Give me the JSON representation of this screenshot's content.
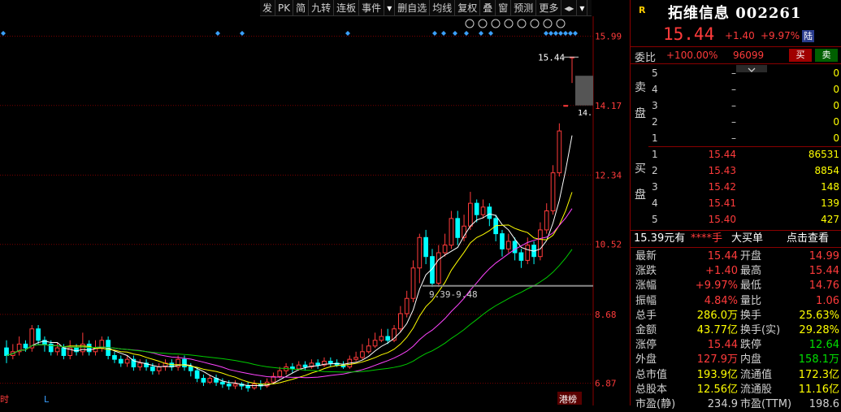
{
  "toolbar": {
    "items": [
      "发",
      "PK",
      "简",
      "九转",
      "连板",
      "事件",
      "▾",
      "删自选",
      "均线",
      "复权",
      "叠",
      "窗",
      "预测",
      "更多",
      "◂▸",
      "▾"
    ]
  },
  "chart": {
    "price_labels": [
      "15.99",
      "14.17",
      "12.34",
      "10.52",
      "8.68",
      "6.87"
    ],
    "last_price_label": "15.44",
    "side_price_label": "14.",
    "gap_annotation": "9.39-9.48",
    "bottom_left": "时",
    "bottom_mid": "L",
    "bottom_right": "港榜",
    "colors": {
      "up": "#ff3b3b",
      "down": "#00ffff",
      "ma5": "#ffffff",
      "ma10": "#ffff00",
      "ma20": "#ff44ff",
      "ma60": "#00cc00"
    }
  },
  "chart_data": {
    "type": "candlestick",
    "ylim": [
      6.5,
      16.3
    ],
    "candles": [
      [
        7.8,
        7.6,
        8.0,
        7.4
      ],
      [
        7.6,
        7.7,
        7.9,
        7.5
      ],
      [
        7.7,
        7.9,
        8.1,
        7.6
      ],
      [
        7.9,
        7.8,
        8.0,
        7.7
      ],
      [
        7.8,
        8.3,
        8.4,
        7.7
      ],
      [
        8.3,
        8.0,
        8.4,
        7.9
      ],
      [
        8.0,
        7.9,
        8.1,
        7.7
      ],
      [
        7.9,
        7.7,
        8.0,
        7.6
      ],
      [
        7.7,
        7.8,
        7.95,
        7.6
      ],
      [
        7.8,
        7.6,
        7.9,
        7.5
      ],
      [
        7.6,
        7.8,
        8.0,
        7.5
      ],
      [
        7.8,
        7.7,
        7.9,
        7.6
      ],
      [
        7.7,
        7.9,
        8.2,
        7.6
      ],
      [
        7.9,
        7.7,
        8.0,
        7.6
      ],
      [
        7.7,
        7.8,
        8.0,
        7.6
      ],
      [
        7.8,
        8.0,
        8.1,
        7.7
      ],
      [
        8.0,
        7.6,
        8.1,
        7.5
      ],
      [
        7.6,
        7.5,
        7.7,
        7.4
      ],
      [
        7.5,
        7.4,
        7.6,
        7.3
      ],
      [
        7.4,
        7.5,
        7.6,
        7.3
      ],
      [
        7.5,
        7.3,
        7.6,
        7.2
      ],
      [
        7.3,
        7.4,
        7.5,
        7.2
      ],
      [
        7.4,
        7.3,
        7.5,
        7.2
      ],
      [
        7.3,
        7.2,
        7.4,
        7.1
      ],
      [
        7.2,
        7.3,
        7.4,
        7.1
      ],
      [
        7.3,
        7.4,
        7.5,
        7.2
      ],
      [
        7.4,
        7.3,
        7.5,
        7.2
      ],
      [
        7.3,
        7.5,
        7.6,
        7.2
      ],
      [
        7.5,
        7.3,
        7.6,
        7.2
      ],
      [
        7.3,
        7.2,
        7.4,
        7.05
      ],
      [
        7.2,
        7.0,
        7.3,
        6.9
      ],
      [
        7.0,
        6.9,
        7.1,
        6.8
      ],
      [
        6.9,
        7.0,
        7.1,
        6.85
      ],
      [
        7.0,
        6.9,
        7.1,
        6.8
      ],
      [
        6.9,
        6.85,
        7.0,
        6.75
      ],
      [
        6.85,
        6.8,
        6.95,
        6.7
      ],
      [
        6.8,
        6.85,
        6.95,
        6.72
      ],
      [
        6.85,
        6.8,
        6.9,
        6.7
      ],
      [
        6.8,
        6.75,
        6.9,
        6.65
      ],
      [
        6.75,
        6.85,
        6.95,
        6.7
      ],
      [
        6.85,
        6.8,
        6.95,
        6.7
      ],
      [
        6.8,
        6.9,
        7.0,
        6.75
      ],
      [
        6.9,
        7.05,
        7.15,
        6.85
      ],
      [
        7.05,
        7.2,
        7.3,
        7.0
      ],
      [
        7.2,
        7.3,
        7.4,
        7.1
      ],
      [
        7.3,
        7.25,
        7.4,
        7.15
      ],
      [
        7.25,
        7.35,
        7.45,
        7.2
      ],
      [
        7.35,
        7.3,
        7.45,
        7.2
      ],
      [
        7.3,
        7.4,
        7.5,
        7.25
      ],
      [
        7.4,
        7.35,
        7.5,
        7.25
      ],
      [
        7.35,
        7.45,
        7.55,
        7.3
      ],
      [
        7.45,
        7.4,
        7.55,
        7.3
      ],
      [
        7.4,
        7.35,
        7.5,
        7.3
      ],
      [
        7.35,
        7.3,
        7.45,
        7.25
      ],
      [
        7.3,
        7.5,
        7.6,
        7.25
      ],
      [
        7.5,
        7.55,
        7.7,
        7.45
      ],
      [
        7.55,
        7.7,
        7.9,
        7.5
      ],
      [
        7.7,
        7.85,
        8.05,
        7.65
      ],
      [
        7.85,
        8.0,
        8.2,
        7.8
      ],
      [
        8.0,
        8.1,
        8.3,
        7.95
      ],
      [
        8.1,
        8.0,
        8.3,
        7.9
      ],
      [
        8.0,
        8.3,
        8.4,
        7.95
      ],
      [
        8.3,
        8.7,
        8.9,
        8.2
      ],
      [
        8.7,
        9.1,
        9.3,
        8.6
      ],
      [
        9.1,
        9.9,
        10.1,
        9.0
      ],
      [
        9.9,
        10.7,
        10.8,
        9.5
      ],
      [
        10.7,
        10.2,
        10.9,
        10.0
      ],
      [
        10.2,
        9.5,
        10.4,
        9.4
      ],
      [
        9.5,
        10.3,
        10.5,
        9.4
      ],
      [
        10.3,
        10.5,
        10.8,
        10.2
      ],
      [
        10.5,
        11.2,
        11.4,
        10.4
      ],
      [
        11.2,
        10.7,
        11.4,
        10.5
      ],
      [
        10.7,
        11.0,
        11.3,
        10.6
      ],
      [
        11.0,
        11.6,
        11.9,
        10.9
      ],
      [
        11.6,
        11.3,
        11.7,
        11.1
      ],
      [
        11.3,
        11.5,
        11.7,
        11.2
      ],
      [
        11.5,
        11.2,
        11.6,
        11.0
      ],
      [
        11.2,
        10.8,
        11.3,
        10.6
      ],
      [
        10.8,
        10.4,
        10.9,
        10.2
      ],
      [
        10.4,
        10.6,
        10.8,
        10.3
      ],
      [
        10.6,
        10.3,
        10.7,
        10.1
      ],
      [
        10.3,
        10.1,
        10.4,
        9.9
      ],
      [
        10.1,
        10.5,
        10.7,
        10.0
      ],
      [
        10.5,
        10.2,
        10.6,
        10.0
      ],
      [
        10.2,
        10.9,
        11.1,
        10.1
      ],
      [
        10.9,
        11.4,
        11.6,
        10.8
      ],
      [
        11.4,
        12.4,
        12.6,
        11.3
      ],
      [
        12.4,
        13.5,
        13.7,
        12.3
      ],
      [
        14.17,
        14.17,
        14.17,
        14.17
      ],
      [
        15.44,
        15.44,
        15.44,
        14.76
      ]
    ],
    "support_level": 9.43
  },
  "panel": {
    "badge": "R",
    "name": "拓维信息 002261",
    "price": "15.44",
    "change": "+1.40",
    "change_pct": "+9.97%",
    "market_badge": "陆",
    "weibi_label": "委比",
    "weibi_pct": "+100.00%",
    "weibi_num": "96099",
    "buy_btn": "买",
    "sell_btn": "卖",
    "sell_label": [
      "卖",
      "盘"
    ],
    "buy_label": [
      "买",
      "盘"
    ],
    "asks": [
      {
        "lv": "5",
        "px": "–",
        "vol": "0"
      },
      {
        "lv": "4",
        "px": "–",
        "vol": "0"
      },
      {
        "lv": "3",
        "px": "–",
        "vol": "0"
      },
      {
        "lv": "2",
        "px": "–",
        "vol": "0"
      },
      {
        "lv": "1",
        "px": "–",
        "vol": "0"
      }
    ],
    "bids": [
      {
        "lv": "1",
        "px": "15.44",
        "vol": "86531"
      },
      {
        "lv": "2",
        "px": "15.43",
        "vol": "8854"
      },
      {
        "lv": "3",
        "px": "15.42",
        "vol": "148"
      },
      {
        "lv": "4",
        "px": "15.41",
        "vol": "139"
      },
      {
        "lv": "5",
        "px": "15.40",
        "vol": "427"
      }
    ],
    "info_head": {
      "a": "15.39元有",
      "b": "****手",
      "c": "大买单",
      "d": "点击查看"
    },
    "stats": [
      {
        "l1": "最新",
        "v1": "15.44",
        "c1": "red",
        "l2": "开盘",
        "v2": "14.99",
        "c2": "red"
      },
      {
        "l1": "涨跌",
        "v1": "+1.40",
        "c1": "red",
        "l2": "最高",
        "v2": "15.44",
        "c2": "red"
      },
      {
        "l1": "涨幅",
        "v1": "+9.97%",
        "c1": "red",
        "l2": "最低",
        "v2": "14.76",
        "c2": "red"
      },
      {
        "l1": "振幅",
        "v1": "4.84%",
        "c1": "red",
        "l2": "量比",
        "v2": "1.06",
        "c2": "red"
      },
      {
        "l1": "总手",
        "v1": "286.0万",
        "c1": "yel",
        "l2": "换手",
        "v2": "25.63%",
        "c2": "yel"
      },
      {
        "l1": "金额",
        "v1": "43.77亿",
        "c1": "yel",
        "l2": "换手(实)",
        "v2": "29.28%",
        "c2": "yel"
      },
      {
        "l1": "涨停",
        "v1": "15.44",
        "c1": "red",
        "l2": "跌停",
        "v2": "12.64",
        "c2": "grn"
      },
      {
        "l1": "外盘",
        "v1": "127.9万",
        "c1": "red",
        "l2": "内盘",
        "v2": "158.1万",
        "c2": "grn"
      },
      {
        "l1": "总市值",
        "v1": "193.9亿",
        "c1": "yel",
        "l2": "流通值",
        "v2": "172.3亿",
        "c2": "yel"
      },
      {
        "l1": "总股本",
        "v1": "12.56亿",
        "c1": "yel",
        "l2": "流通股",
        "v2": "11.16亿",
        "c2": "yel"
      },
      {
        "l1": "市盈(静)",
        "v1": "234.9",
        "c1": "wht",
        "l2": "市盈(TTM)",
        "v2": "198.6",
        "c2": "wht"
      }
    ]
  }
}
